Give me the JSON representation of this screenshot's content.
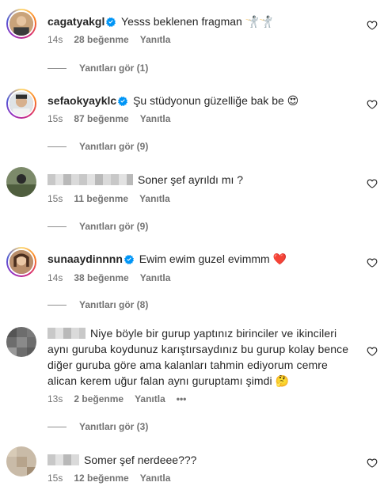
{
  "comments": [
    {
      "username": "cagatyakgl",
      "verified": true,
      "text": "Yesss beklenen fragman 🤺🤺",
      "time": "14s",
      "likes": "28 beğenme",
      "reply": "Yanıtla",
      "view_replies": "Yanıtları gör (1)"
    },
    {
      "username": "sefaokyayklc",
      "verified": true,
      "text": "Şu stüdyonun güzelliğe bak be 😍",
      "time": "15s",
      "likes": "87 beğenme",
      "reply": "Yanıtla",
      "view_replies": "Yanıtları gör (9)"
    },
    {
      "username": "",
      "verified": false,
      "text": "Soner şef ayrıldı mı ?",
      "time": "15s",
      "likes": "11 beğenme",
      "reply": "Yanıtla",
      "view_replies": "Yanıtları gör (9)"
    },
    {
      "username": "sunaaydinnnn",
      "verified": true,
      "text": "Ewim ewim guzel evimmm ❤️",
      "time": "14s",
      "likes": "38 beğenme",
      "reply": "Yanıtla",
      "view_replies": "Yanıtları gör (8)"
    },
    {
      "username": "",
      "verified": false,
      "text": "Niye böyle bir gurup yaptınız birinciler ve ikincileri aynı guruba koydunuz karıştırsaydınız bu gurup kolay bence diğer guruba göre ama kalanları tahmin ediyorum cemre alican kerem uğur falan aynı guruptamı şimdi 🤔",
      "time": "13s",
      "likes": "2 beğenme",
      "reply": "Yanıtla",
      "more": "•••",
      "view_replies": "Yanıtları gör (3)"
    },
    {
      "username": "",
      "verified": false,
      "text": "Somer şef nerdeee???",
      "time": "15s",
      "likes": "12 beğenme",
      "reply": "Yanıtla"
    }
  ],
  "colors": {
    "text": "#262626",
    "secondary": "#737373",
    "verified_badge": "#0095f6"
  }
}
